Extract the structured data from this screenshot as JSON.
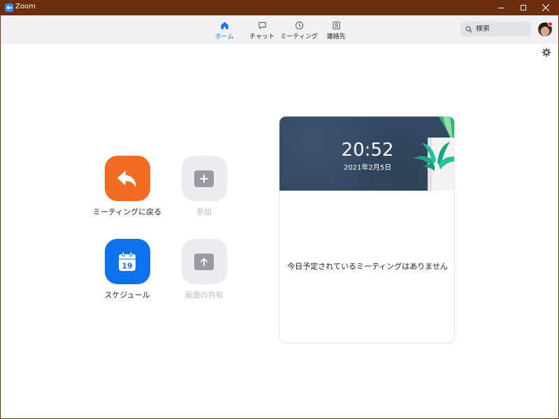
{
  "window": {
    "title": "Zoom"
  },
  "nav": {
    "tabs": [
      {
        "label": "ホーム",
        "icon": "home-icon",
        "active": true
      },
      {
        "label": "チャット",
        "icon": "chat-icon",
        "active": false
      },
      {
        "label": "ミーティング",
        "icon": "clock-icon",
        "active": false
      },
      {
        "label": "連絡先",
        "icon": "contacts-icon",
        "active": false
      }
    ],
    "search_placeholder": "検索"
  },
  "actions": {
    "rejoin": {
      "label": "ミーティングに戻る",
      "icon": "rejoin-arrow-icon",
      "enabled": true,
      "color": "#f26d21"
    },
    "join": {
      "label": "参加",
      "icon": "plus-icon",
      "enabled": false
    },
    "schedule": {
      "label": "スケジュール",
      "icon": "calendar-icon",
      "day": "19",
      "enabled": true,
      "color": "#0e72ed"
    },
    "share": {
      "label": "画面の共有",
      "icon": "share-up-arrow-icon",
      "enabled": false
    }
  },
  "calendar_card": {
    "time": "20:52",
    "date": "2021年2月5日",
    "empty_message": "今日予定されているミーティングはありません"
  },
  "colors": {
    "accent": "#0e72ed",
    "titlebar": "#6b2e0e",
    "banner": "#344a63"
  }
}
